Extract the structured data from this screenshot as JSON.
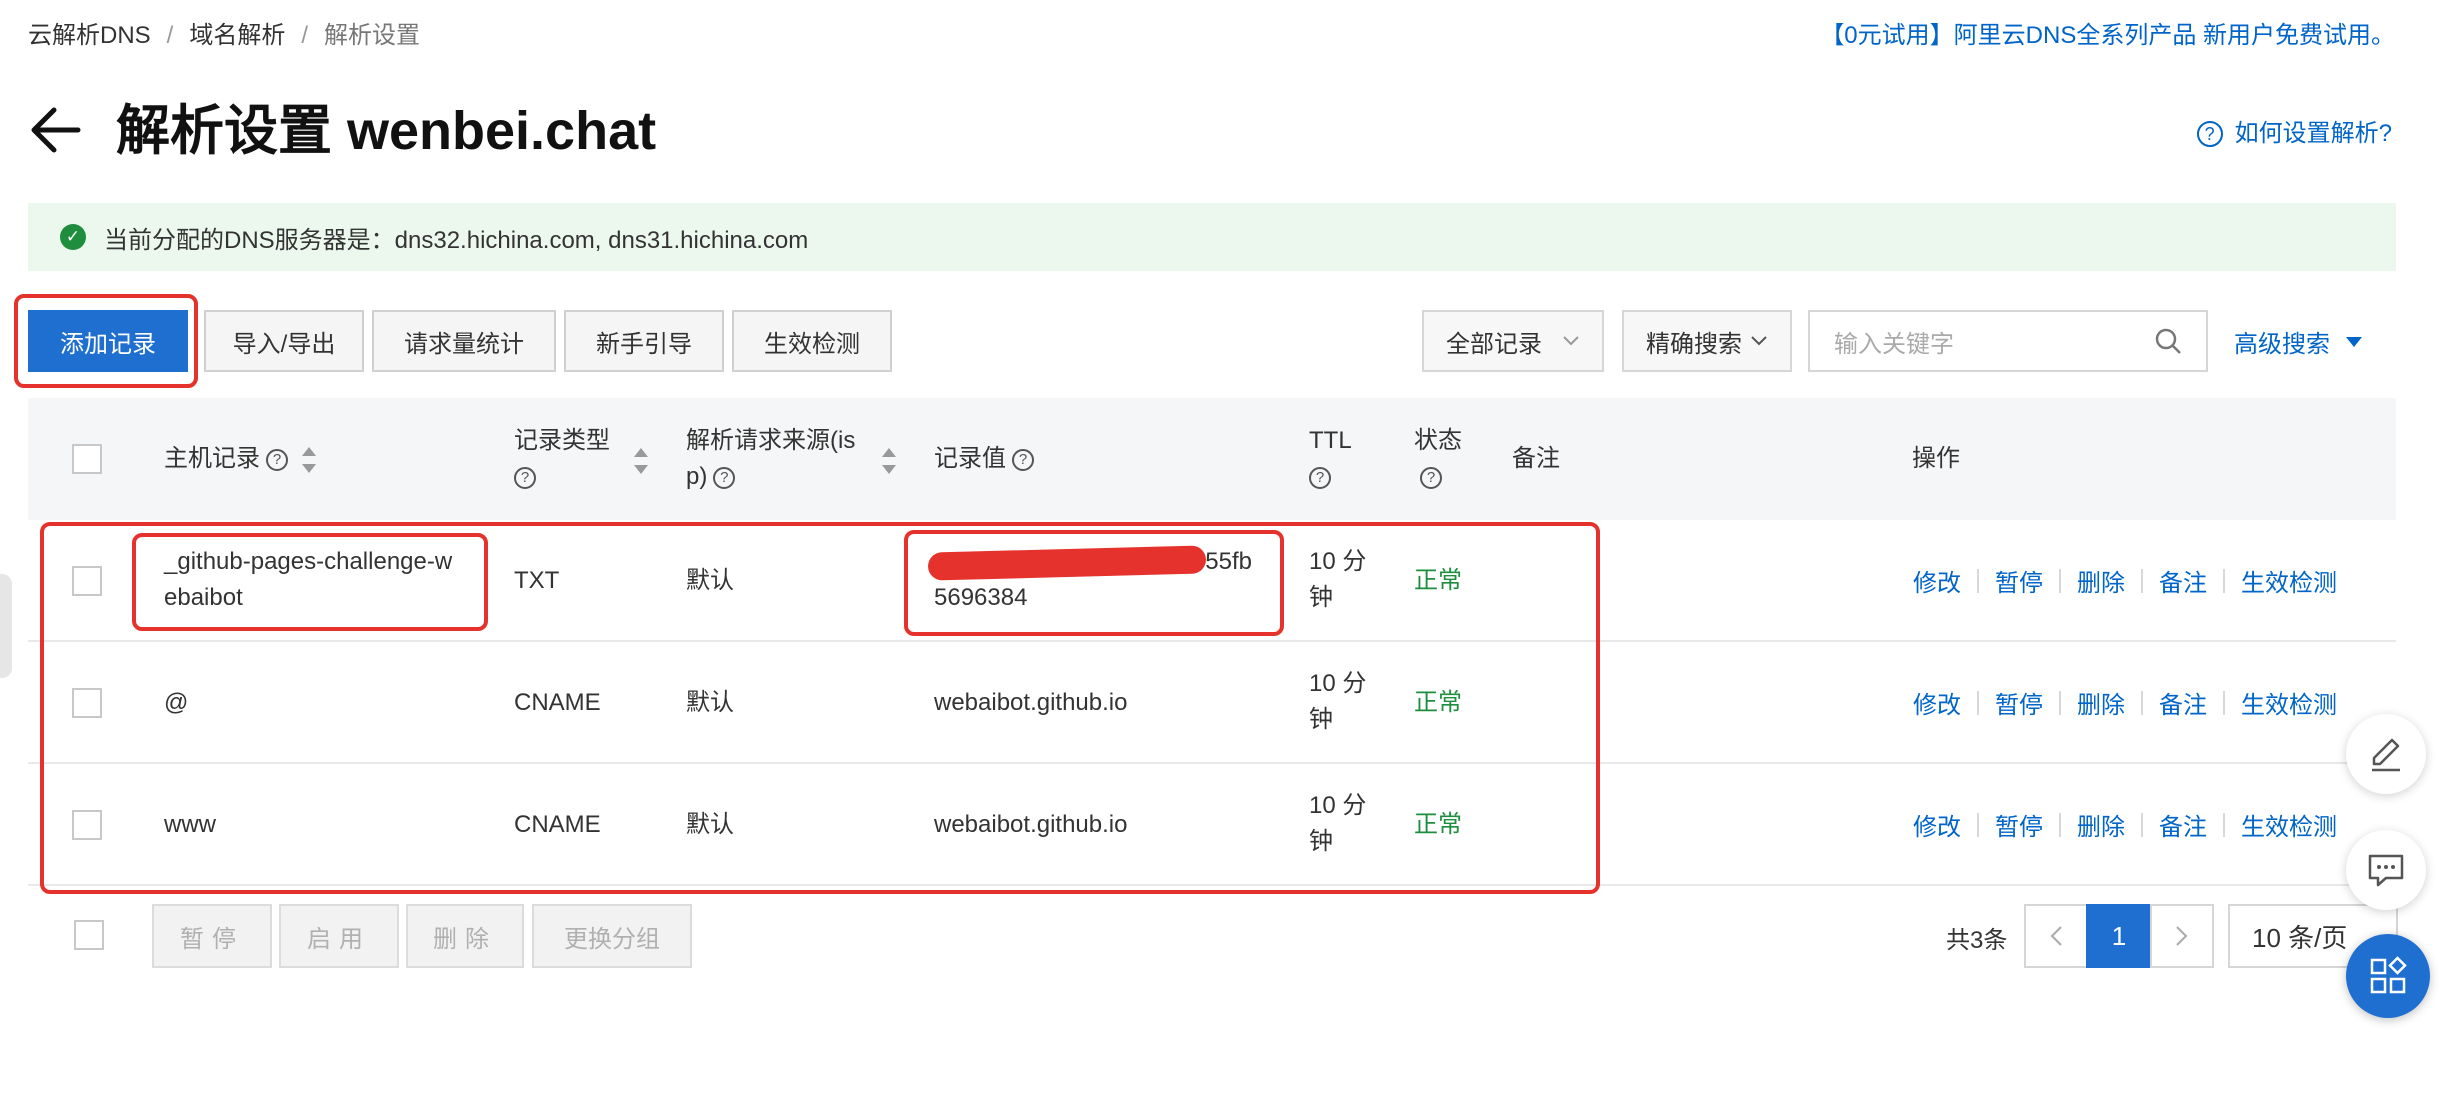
{
  "breadcrumb": {
    "item1": "云解析DNS",
    "item2": "域名解析",
    "current": "解析设置",
    "separator": "/"
  },
  "promo": "【0元试用】阿里云DNS全系列产品 新用户免费试用。",
  "header": {
    "title": "解析设置 wenbei.chat",
    "help_link": "如何设置解析?"
  },
  "notice": {
    "text": "当前分配的DNS服务器是：dns32.hichina.com, dns31.hichina.com"
  },
  "toolbar": {
    "add": "添加记录",
    "import_export": "导入/导出",
    "stats": "请求量统计",
    "guide": "新手引导",
    "check": "生效检测",
    "filter_select": "全部记录",
    "search_mode": "精确搜索",
    "search_placeholder": "输入关键字",
    "advanced": "高级搜索"
  },
  "table": {
    "columns": {
      "host": "主机记录",
      "type_line1": "记录类型",
      "isp_line1": "解析请求来源(is",
      "isp_line2": "p)",
      "value": "记录值",
      "ttl": "TTL",
      "status": "状态",
      "remark": "备注",
      "ops": "操作"
    },
    "rows": [
      {
        "host_line1": "_github-pages-challenge-w",
        "host_line2": "ebaibot",
        "type": "TXT",
        "isp": "默认",
        "value_line1": "2555fb",
        "value_line2": "5696384",
        "ttl_line1": "10 分",
        "ttl_line2": "钟",
        "status": "正常"
      },
      {
        "host_line1": "@",
        "type": "CNAME",
        "isp": "默认",
        "value_line1": "webaibot.github.io",
        "ttl_line1": "10 分",
        "ttl_line2": "钟",
        "status": "正常"
      },
      {
        "host_line1": "www",
        "type": "CNAME",
        "isp": "默认",
        "value_line1": "webaibot.github.io",
        "ttl_line1": "10 分",
        "ttl_line2": "钟",
        "status": "正常"
      }
    ],
    "actions": [
      "修改",
      "暂停",
      "删除",
      "备注",
      "生效检测"
    ]
  },
  "footer": {
    "pause": "暂停",
    "enable": "启用",
    "delete": "删除",
    "change_group": "更换分组",
    "total": "共3条",
    "current_page": "1",
    "page_size": "10 条/页"
  },
  "colors": {
    "primary": "#1f6fd0",
    "link": "#0064c8",
    "success": "#1e8e3e",
    "annotation": "#e5322d",
    "notice_bg": "#ecf8ee"
  },
  "icons": [
    "back-arrow-icon",
    "help-icon",
    "check-circle-icon",
    "chevron-down-icon",
    "search-icon",
    "sort-icon",
    "edit-icon",
    "chat-icon",
    "apps-icon"
  ]
}
